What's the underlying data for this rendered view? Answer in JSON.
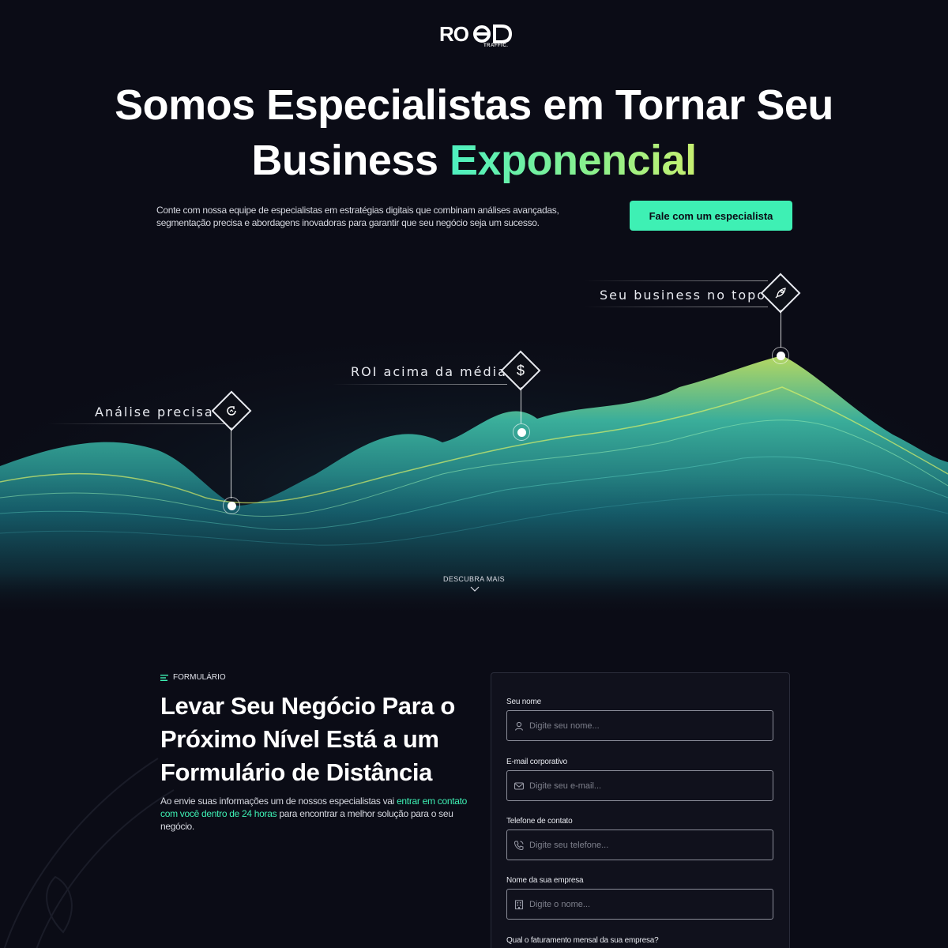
{
  "brand": {
    "logo_text": "ROOD",
    "logo_sub": "TRAFFIC."
  },
  "hero": {
    "title_line1": "Somos Especialistas em Tornar Seu",
    "title_line2_plain": "Business ",
    "title_line2_accent": "Exponencial",
    "description": "Conte com nossa equipe de especialistas em estratégias digitais que combinam análises avançadas, segmentação precisa e abordagens inovadoras para garantir que seu negócio seja um sucesso.",
    "cta_label": "Fale com um especialista"
  },
  "markers": [
    {
      "label": "Análise precisa",
      "icon": "chart-refresh-icon"
    },
    {
      "label": "ROI acima da média",
      "icon": "dollar-icon"
    },
    {
      "label": "Seu business no topo",
      "icon": "rocket-icon"
    }
  ],
  "discover": {
    "label": "DESCUBRA MAIS",
    "icon": "chevron-down-icon"
  },
  "form_section": {
    "tag": "FORMULÁRIO",
    "title": "Levar Seu Negócio Para o Próximo Nível Está a um Formulário de Distância",
    "desc_part1": "Ao envie suas informações um de nossos especialistas vai ",
    "desc_highlight": "entrar em contato com você dentro de 24 horas",
    "desc_part2": " para encontrar a melhor solução para o seu negócio."
  },
  "form": {
    "fields": [
      {
        "label": "Seu nome",
        "placeholder": "Digite seu nome...",
        "icon": "user-icon"
      },
      {
        "label": "E-mail corporativo",
        "placeholder": "Digite seu e-mail...",
        "icon": "mail-icon"
      },
      {
        "label": "Telefone de contato",
        "placeholder": "Digite seu telefone...",
        "icon": "phone-icon"
      },
      {
        "label": "Nome da sua empresa",
        "placeholder": "Digite o nome...",
        "icon": "building-icon"
      }
    ],
    "revenue_question": "Qual o faturamento mensal da sua empresa?"
  },
  "colors": {
    "background": "#0b0c16",
    "accent": "#3ef0b4",
    "card": "#10111c"
  }
}
